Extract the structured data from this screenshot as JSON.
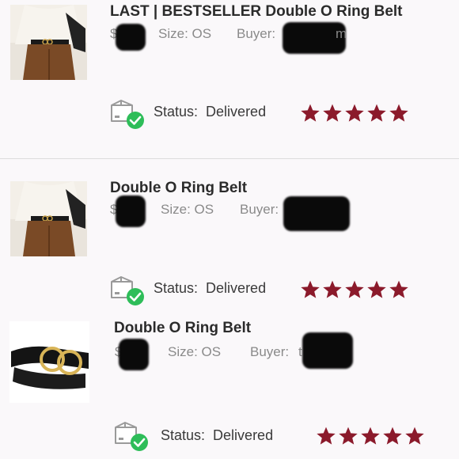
{
  "listings": [
    {
      "title": "LAST | BESTSELLER Double O Ring Belt",
      "price_prefix": "$",
      "size_label": "Size: OS",
      "buyer_label": "Buyer:",
      "buyer_visible_fragment": "m",
      "status_label": "Status:",
      "status_value": "Delivered",
      "rating": 5,
      "thumbnail": "outfit-photo"
    },
    {
      "title": "Double O Ring Belt",
      "price_prefix": "$",
      "size_label": "Size: OS",
      "buyer_label": "Buyer:",
      "buyer_visible_fragment": "",
      "status_label": "Status:",
      "status_value": "Delivered",
      "rating": 5,
      "thumbnail": "outfit-photo"
    },
    {
      "title": "Double O Ring Belt",
      "price_prefix": "$",
      "size_label": "Size: OS",
      "buyer_label": "Buyer:",
      "buyer_visible_fragment": "t",
      "status_label": "Status:",
      "status_value": "Delivered",
      "rating": 5,
      "thumbnail": "belt-photo"
    }
  ],
  "colors": {
    "star": "#8b1a2b",
    "check_badge": "#2ebd59",
    "divider": "#dcdcdc"
  },
  "icons": [
    "delivered-box-icon",
    "star-icon"
  ]
}
